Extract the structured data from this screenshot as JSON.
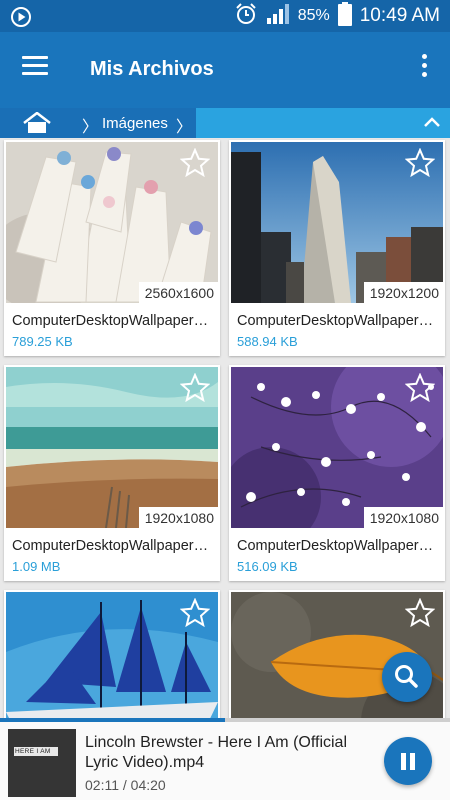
{
  "status_bar": {
    "battery_percent": "85%",
    "time": "10:49 AM",
    "icons": [
      "play-circle-icon",
      "alarm-icon",
      "signal-icon",
      "battery-icon"
    ]
  },
  "toolbar": {
    "title": "Mis Archivos",
    "menu_icon": "hamburger-menu-icon",
    "overflow_icon": "more-vert-icon"
  },
  "breadcrumb": {
    "home_icon": "home-icon",
    "items": [
      "Imágenes"
    ],
    "collapse_icon": "chevron-up-icon"
  },
  "files": [
    {
      "name": "ComputerDesktopWallpapersCollection",
      "dimensions": "2560x1600",
      "size": "789.25 KB",
      "thumb": "colored-pencils"
    },
    {
      "name": "ComputerDesktopWallpapersCollection",
      "dimensions": "1920x1200",
      "size": "588.94 KB",
      "thumb": "flatiron-building"
    },
    {
      "name": "ComputerDesktopWallpapersCollection",
      "dimensions": "1920x1080",
      "size": "1.09 MB",
      "thumb": "beach"
    },
    {
      "name": "ComputerDesktopWallpapersCollection",
      "dimensions": "1920x1080",
      "size": "516.09 KB",
      "thumb": "purple-flowers"
    },
    {
      "name": "",
      "dimensions": "",
      "size": "",
      "thumb": "sailing-ship"
    },
    {
      "name": "",
      "dimensions": "",
      "size": "",
      "thumb": "autumn-leaf"
    }
  ],
  "fab": {
    "icon": "search-icon"
  },
  "player": {
    "title": "Lincoln Brewster - Here I Am (Official Lyric Video).mp4",
    "time": "02:11 / 04:20",
    "progress": 0.5,
    "cover_text": "HERE I AM",
    "pause_icon": "pause-icon"
  },
  "colors": {
    "status_bar": "#1565a8",
    "toolbar": "#1a75bc",
    "breadcrumb": "#2aa3e0",
    "size_text": "#2a9fd8"
  }
}
